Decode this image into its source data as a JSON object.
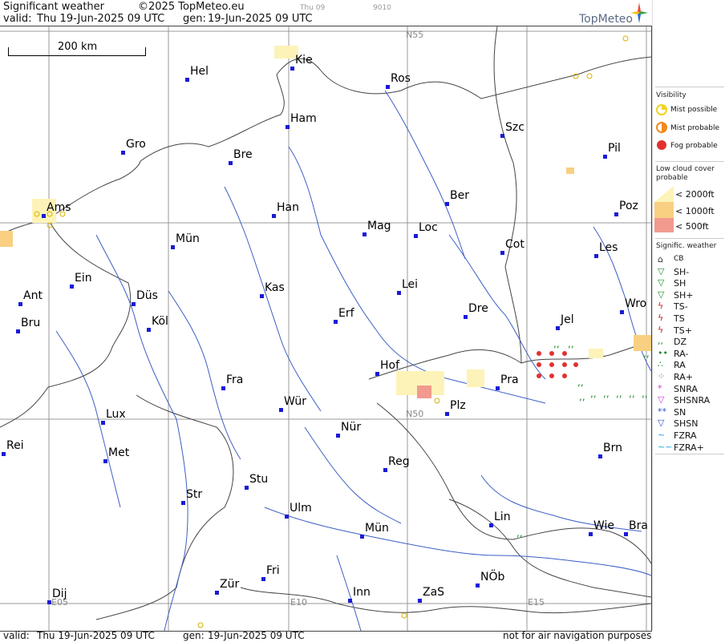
{
  "header": {
    "title": "Significant weather",
    "copyright": "©2025 TopMeteo.eu",
    "small_time": "Thu 09",
    "small_code": "9010",
    "valid_label": "valid:",
    "valid_value": "Thu  19-Jun-2025  09 UTC",
    "gen_label": "gen:",
    "gen_value": "19-Jun-2025 09 UTC",
    "logo_text": "TopMeteo"
  },
  "map": {
    "scale_label": "200 km",
    "grid_labels": [
      "N55",
      "N50",
      "E05",
      "E10",
      "E15"
    ],
    "cities": [
      {
        "name": "Kie"
      },
      {
        "name": "Hel"
      },
      {
        "name": "Ros"
      },
      {
        "name": "Ham"
      },
      {
        "name": "Szc"
      },
      {
        "name": "Gro"
      },
      {
        "name": "Bre"
      },
      {
        "name": "Pil"
      },
      {
        "name": "Ber"
      },
      {
        "name": "Ams"
      },
      {
        "name": "Han"
      },
      {
        "name": "Poz"
      },
      {
        "name": "Mag"
      },
      {
        "name": "Loc"
      },
      {
        "name": "Mün"
      },
      {
        "name": "Cot"
      },
      {
        "name": "Les"
      },
      {
        "name": "Ein"
      },
      {
        "name": "Kas"
      },
      {
        "name": "Lei"
      },
      {
        "name": "Ant"
      },
      {
        "name": "Düs"
      },
      {
        "name": "Wro"
      },
      {
        "name": "Dre"
      },
      {
        "name": "Erf"
      },
      {
        "name": "Jel"
      },
      {
        "name": "Bru"
      },
      {
        "name": "Köl"
      },
      {
        "name": "Hof"
      },
      {
        "name": "Fra"
      },
      {
        "name": "Pra"
      },
      {
        "name": "Wür"
      },
      {
        "name": "Lux"
      },
      {
        "name": "Plz"
      },
      {
        "name": "Nür"
      },
      {
        "name": "Rei"
      },
      {
        "name": "Met"
      },
      {
        "name": "Brn"
      },
      {
        "name": "Reg"
      },
      {
        "name": "Stu"
      },
      {
        "name": "Str"
      },
      {
        "name": "Ulm"
      },
      {
        "name": "Lin"
      },
      {
        "name": "Wie"
      },
      {
        "name": "Bra"
      },
      {
        "name": "Mün"
      },
      {
        "name": "Fri"
      },
      {
        "name": "Dij"
      },
      {
        "name": "Zür"
      },
      {
        "name": "NÖb"
      },
      {
        "name": "ZaS"
      },
      {
        "name": "Inn"
      }
    ]
  },
  "legend": {
    "visibility_title": "Visibility",
    "mist_possible": "Mist possible",
    "mist_probable": "Mist probable",
    "fog_probable": "Fog probable",
    "low_cloud_title_1": "Low cloud cover",
    "low_cloud_title_2": "probable",
    "lc_2000": "< 2000ft",
    "lc_1000": "< 1000ft",
    "lc_500": "<  500ft",
    "sig_title": "Signific. weather",
    "sig_items": [
      "CB",
      "SH-",
      "SH",
      "SH+",
      "TS-",
      "TS",
      "TS+",
      "DZ",
      "RA-",
      "RA",
      "RA+",
      "SNRA",
      "SHSNRA",
      "SN",
      "SHSN",
      "FZRA",
      "FZRA+"
    ],
    "colors": {
      "mist_possible": "#f3d21e",
      "mist_probable": "#f28a1c",
      "fog_probable": "#e23030",
      "lc_2000": "#fdf3b8",
      "lc_1000": "#f9cf82",
      "lc_500": "#f29a8e"
    }
  },
  "footer": {
    "valid_label": "valid:",
    "valid_value": "Thu  19-Jun-2025  09 UTC",
    "gen_label": "gen:",
    "gen_value": "19-Jun-2025 09 UTC",
    "disclaimer": "not for air navigation purposes"
  }
}
